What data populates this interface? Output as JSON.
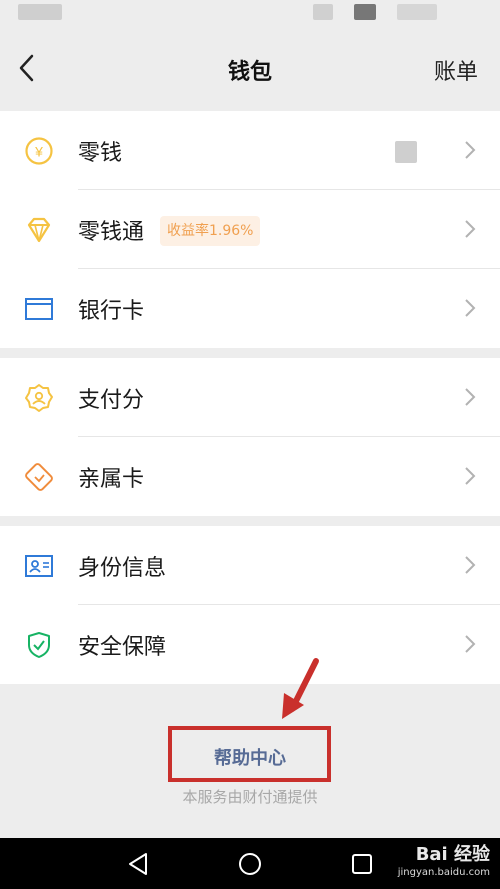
{
  "header": {
    "title": "钱包",
    "bill_label": "账单"
  },
  "groups": [
    {
      "items": [
        {
          "label": "零钱",
          "icon": "coin-yen-icon"
        },
        {
          "label": "零钱通",
          "icon": "diamond-icon",
          "badge": "收益率1.96%"
        },
        {
          "label": "银行卡",
          "icon": "bank-card-icon"
        }
      ]
    },
    {
      "items": [
        {
          "label": "支付分",
          "icon": "pay-score-icon"
        },
        {
          "label": "亲属卡",
          "icon": "family-card-icon"
        }
      ]
    },
    {
      "items": [
        {
          "label": "身份信息",
          "icon": "id-card-icon"
        },
        {
          "label": "安全保障",
          "icon": "shield-check-icon"
        }
      ]
    }
  ],
  "footer": {
    "help_label": "帮助中心",
    "provider_text": "本服务由财付通提供"
  },
  "watermark": {
    "brand": "Bai 经验",
    "url": "jingyan.baidu.com"
  },
  "colors": {
    "accent_link": "#576b95",
    "annotation_red": "#c9302c",
    "icon_yellow": "#f5c342",
    "icon_blue": "#2f7ad8",
    "icon_orange": "#f08c3c",
    "icon_green": "#17b364"
  }
}
